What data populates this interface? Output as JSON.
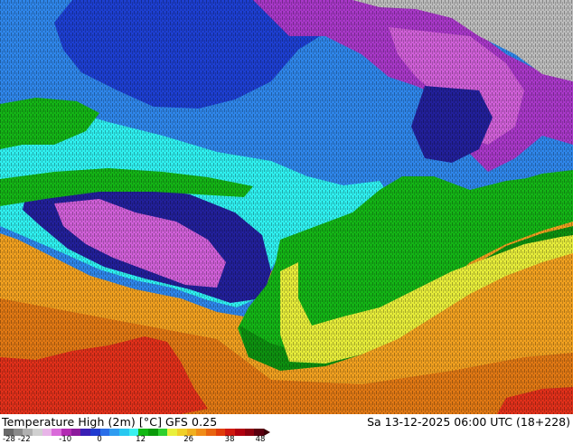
{
  "map": {
    "variable": "Temperature High (2m) [°C]",
    "model": "GFS 0.25",
    "valid_time": "Sa 13-12-2025 06:00 UTC (18+228)"
  },
  "colorbar": {
    "ticks": [
      "-28",
      "-22",
      "-10",
      "0",
      "12",
      "26",
      "38",
      "48"
    ],
    "tick_values": [
      -28,
      -22,
      -10,
      0,
      12,
      26,
      38,
      48
    ],
    "range": [
      -28,
      48
    ],
    "colors": [
      "#6a6a6a",
      "#8a8a8a",
      "#b0b0b0",
      "#d0d0d0",
      "#e8b4e8",
      "#d96ad9",
      "#b22ab2",
      "#8c1a9c",
      "#3a1fb5",
      "#1f3ad0",
      "#2a6ee8",
      "#2f9cf0",
      "#27c8f0",
      "#3af0f0",
      "#12b814",
      "#0a9a0a",
      "#2ed02e",
      "#e8f03c",
      "#f0d028",
      "#f0b020",
      "#f08c18",
      "#e86410",
      "#e03c0a",
      "#d01810",
      "#b00010",
      "#8a0010",
      "#5a0010"
    ]
  },
  "palette": {
    "ocean_deep": "#1d3fd1",
    "ocean_mid": "#2f86ea",
    "cold_light": "#3ad0ee",
    "cyan": "#2ff0f0",
    "green": "#14b416",
    "green_dark": "#0e9010",
    "yellow": "#e6ec3a",
    "orange": "#f0a020",
    "orange_dark": "#e07814",
    "red": "#e0301a",
    "magenta": "#d060d8",
    "purple": "#a838c8",
    "navy": "#22209a",
    "grey": "#bdbdbd"
  }
}
